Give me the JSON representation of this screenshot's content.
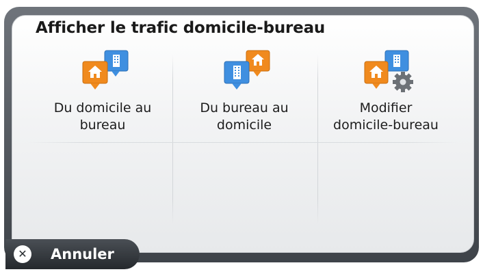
{
  "dialog": {
    "title": "Afficher le trafic domicile-bureau"
  },
  "options": [
    {
      "line1": "Du domicile au",
      "line2": "bureau",
      "icon": "home-to-office-icon"
    },
    {
      "line1": "Du bureau au",
      "line2": "domicile",
      "icon": "office-to-home-icon"
    },
    {
      "line1": "Modifier",
      "line2": "domicile-bureau",
      "icon": "edit-commute-icon"
    }
  ],
  "footer": {
    "cancel_label": "Annuler",
    "cancel_icon": "close-icon"
  },
  "colors": {
    "home_marker": "#f08a1e",
    "office_marker": "#3f8fe0",
    "frame": "#4a4f55"
  }
}
